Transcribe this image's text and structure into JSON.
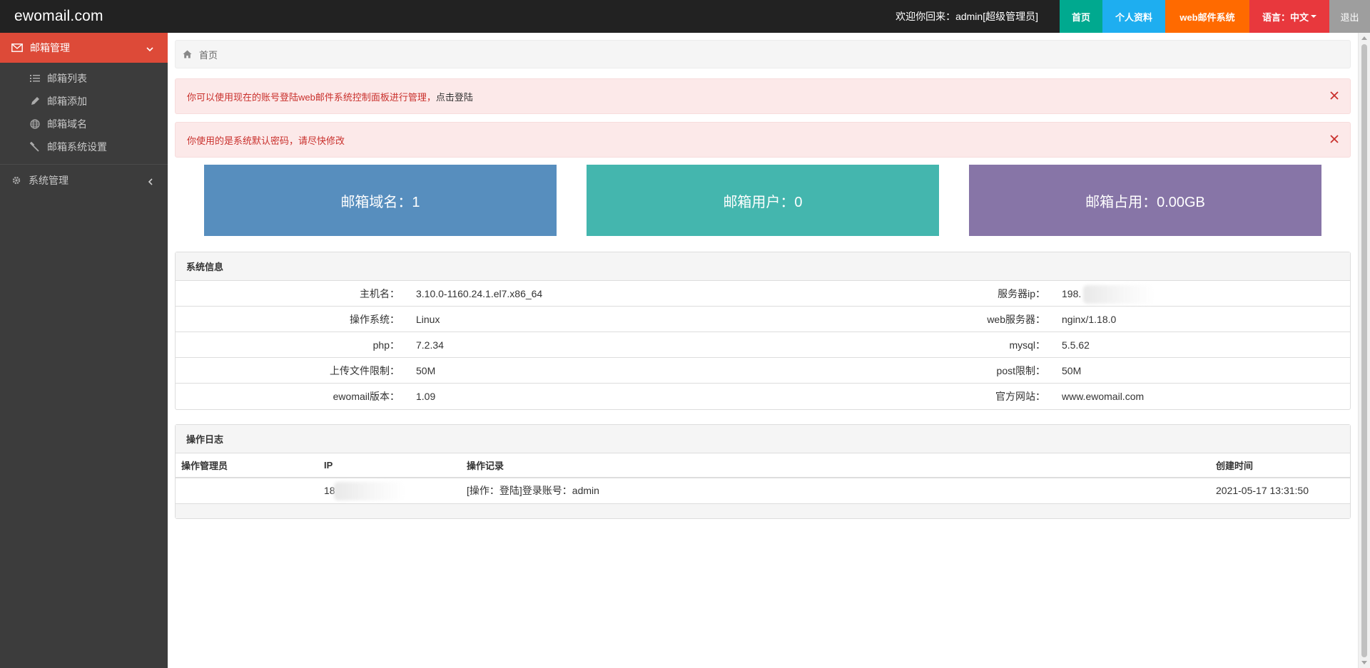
{
  "brand": "ewomail.com",
  "header": {
    "welcome": "欢迎你回来：admin[超级管理员]",
    "nav": [
      {
        "label": "首页",
        "color": "#00a98f"
      },
      {
        "label": "个人资料",
        "color": "#1eaef0"
      },
      {
        "label": "web邮件系统",
        "color": "#ff6a00"
      },
      {
        "label": "语言：中文",
        "color": "#e8383d"
      },
      {
        "label": "退出",
        "color": "#9e9e9e"
      }
    ]
  },
  "sidebar": {
    "active_group": {
      "label": "邮箱管理",
      "icon": "envelope-icon",
      "color": "#dd4a38"
    },
    "items": [
      {
        "label": "邮箱列表",
        "icon": "list-icon"
      },
      {
        "label": "邮箱添加",
        "icon": "pencil-icon"
      },
      {
        "label": "邮箱域名",
        "icon": "globe-icon"
      },
      {
        "label": "邮箱系统设置",
        "icon": "wrench-icon"
      }
    ],
    "groups": [
      {
        "label": "系统管理",
        "icon": "gear-icon"
      }
    ]
  },
  "breadcrumb": {
    "home_icon": "home-icon",
    "label": "首页"
  },
  "alerts": [
    {
      "text": "你可以使用现在的账号登陆web邮件系统控制面板进行管理，",
      "link": "点击登陆"
    },
    {
      "text": "你使用的是系统默认密码，请尽快修改",
      "link": ""
    }
  ],
  "stats": [
    {
      "label": "邮箱域名：1",
      "color": "#578ebe"
    },
    {
      "label": "邮箱用户：0",
      "color": "#44b6ae"
    },
    {
      "label": "邮箱占用：0.00GB",
      "color": "#8775a7"
    }
  ],
  "system_info": {
    "title": "系统信息",
    "rows": [
      {
        "l1": "主机名：",
        "v1": "3.10.0-1160.24.1.el7.x86_64",
        "l2": "服务器ip：",
        "v2": "198."
      },
      {
        "l1": "操作系统：",
        "v1": "Linux",
        "l2": "web服务器：",
        "v2": "nginx/1.18.0"
      },
      {
        "l1": "php：",
        "v1": "7.2.34",
        "l2": "mysql：",
        "v2": "5.5.62"
      },
      {
        "l1": "上传文件限制：",
        "v1": "50M",
        "l2": "post限制：",
        "v2": "50M"
      },
      {
        "l1": "ewomail版本：",
        "v1": "1.09",
        "l2": "官方网站：",
        "v2": "www.ewomail.com"
      }
    ]
  },
  "op_log": {
    "title": "操作日志",
    "columns": [
      "操作管理员",
      "IP",
      "操作记录",
      "创建时间"
    ],
    "rows": [
      {
        "admin": "",
        "ip": "18",
        "record": "[操作：登陆]登录账号：admin",
        "time": "2021-05-17 13:31:50"
      }
    ]
  }
}
